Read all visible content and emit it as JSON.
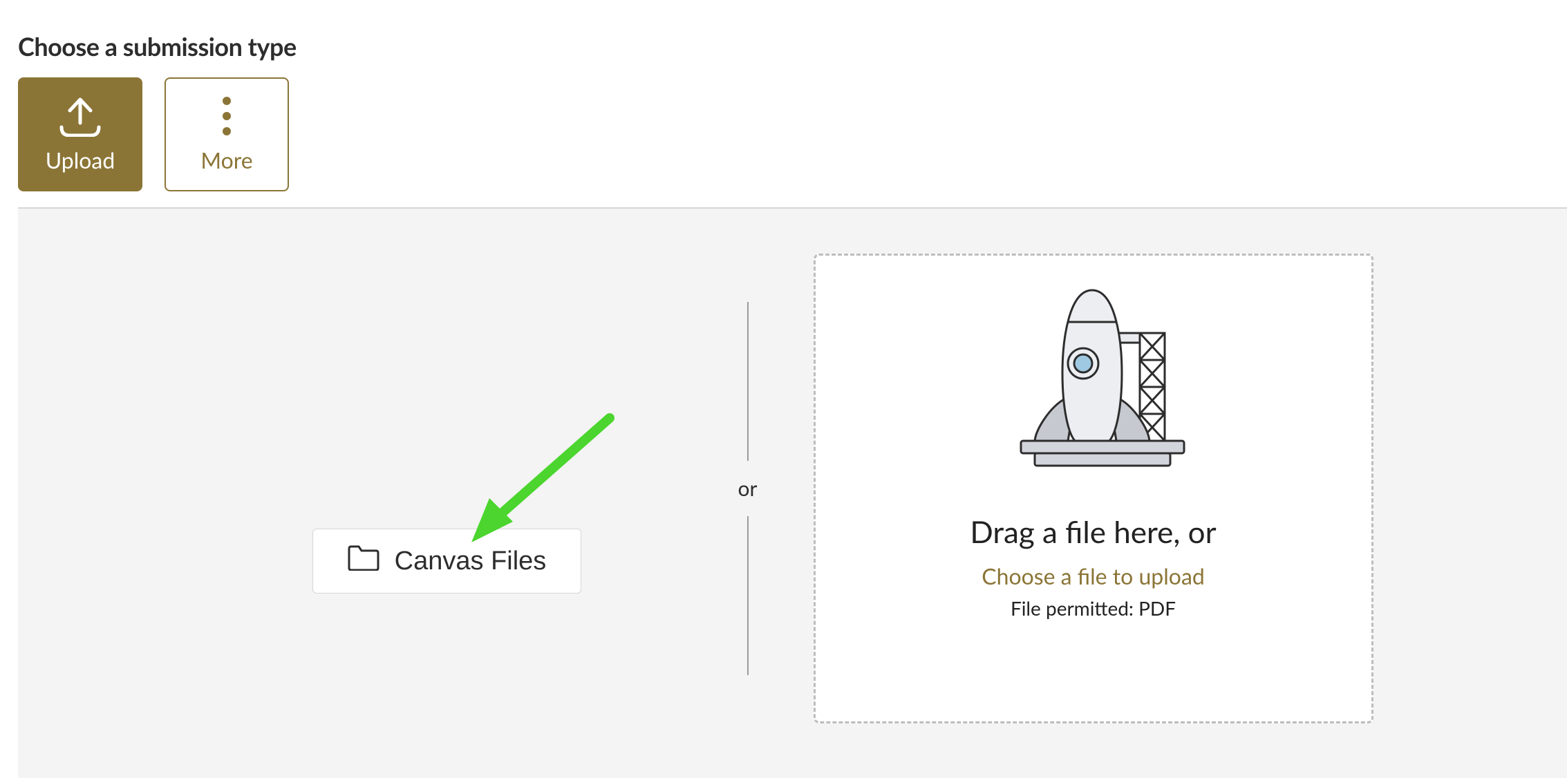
{
  "heading": "Choose a submission type",
  "tabs": {
    "upload_label": "Upload",
    "more_label": "More"
  },
  "left": {
    "canvas_files_label": "Canvas Files"
  },
  "separator": {
    "or_label": "or"
  },
  "dropzone": {
    "title": "Drag a file here, or",
    "choose_label": "Choose a file to upload",
    "permitted_label": "File permitted: PDF"
  },
  "colors": {
    "accent": "#8b7536",
    "arrow": "#4bd52e"
  }
}
